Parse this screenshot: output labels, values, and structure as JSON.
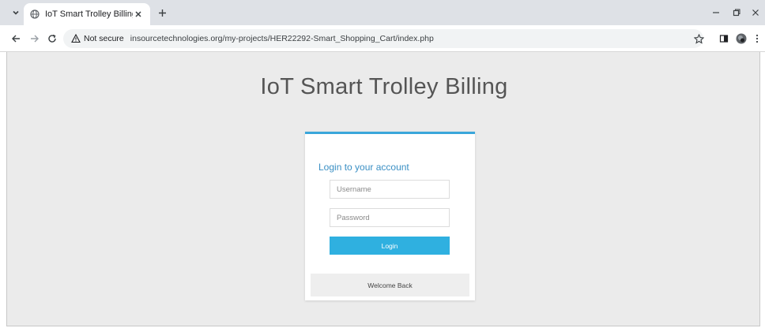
{
  "browser": {
    "tab": {
      "title": "IoT Smart Trolley Billing - Login",
      "favicon": "globe-icon"
    },
    "address_bar": {
      "security_label": "Not secure",
      "url": "insourcetechnologies.org/my-projects/HER22292-Smart_Shopping_Cart/index.php"
    }
  },
  "page": {
    "title": "IoT Smart Trolley Billing",
    "login": {
      "heading": "Login to your account",
      "username_placeholder": "Username",
      "password_placeholder": "Password",
      "button_label": "Login",
      "footer_text": "Welcome Back"
    }
  },
  "colors": {
    "accent": "#3aa6db",
    "button": "#2fb0e0",
    "heading": "#3a8fc4",
    "page_background": "#ebebeb"
  }
}
